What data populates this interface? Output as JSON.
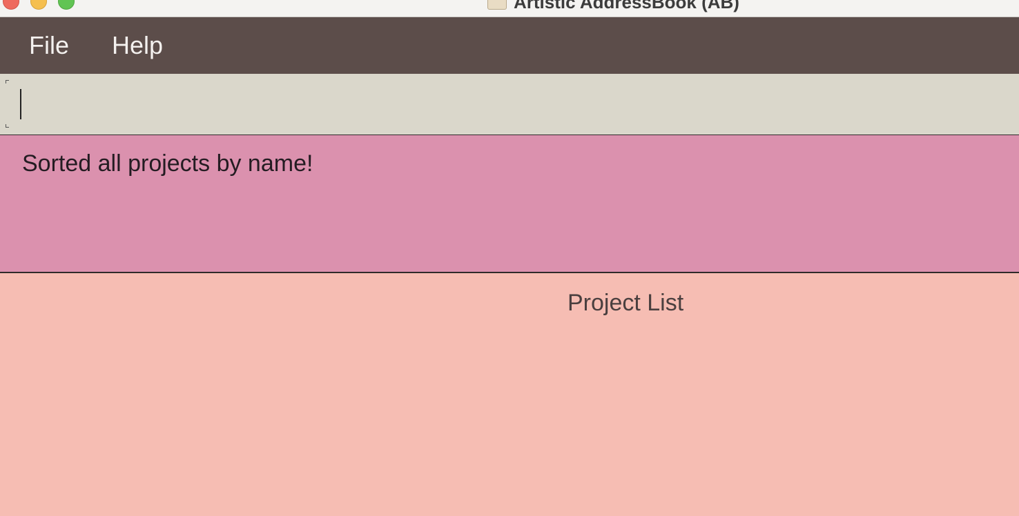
{
  "window": {
    "title": "Artistic AddressBook (AB)",
    "icon": "addressbook-app-icon"
  },
  "menu": {
    "items": [
      {
        "label": "File"
      },
      {
        "label": "Help"
      }
    ]
  },
  "command_box": {
    "value": "",
    "placeholder": ""
  },
  "result": {
    "message": "Sorted all projects by name!"
  },
  "project_list": {
    "title": "Project List"
  },
  "colors": {
    "menubar": "#5c4d4a",
    "command_bg": "#dad7cb",
    "result_bg": "#db91ae",
    "list_bg": "#f6bdb3"
  }
}
